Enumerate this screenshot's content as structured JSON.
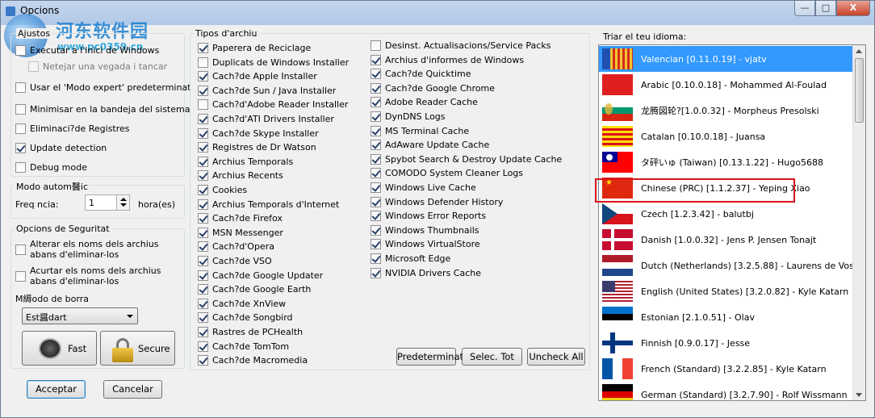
{
  "window": {
    "title": "Opcions",
    "min_label": "—",
    "max_label": "□",
    "close_label": "X"
  },
  "watermark": {
    "site_name": "河东软件园",
    "url": "www.pc0359.cn"
  },
  "left": {
    "general_group": "Ajustos",
    "general": [
      {
        "label": "Executar a l'inici de Windows",
        "checked": false,
        "disabled": false
      },
      {
        "label": "Netejar una vegada i tancar",
        "checked": false,
        "disabled": true
      },
      {
        "label": "Usar el 'Modo expert' predeterminat",
        "checked": false,
        "disabled": false
      },
      {
        "label": "Minimisar en la bandeja del sistema",
        "checked": false,
        "disabled": false
      },
      {
        "label": "Eliminaci?de Registres",
        "checked": false,
        "disabled": false
      },
      {
        "label": "Update detection",
        "checked": true,
        "disabled": false
      },
      {
        "label": "Debug mode",
        "checked": false,
        "disabled": false
      }
    ],
    "auto_group": "Modo autom醫ic",
    "frequency_label": "Freq    ncia:",
    "frequency_value": "1",
    "frequency_unit": "hora(es)",
    "security_group": "Opcions de Seguritat",
    "security": [
      {
        "label": "Alterar els noms dels archius abans d'eliminar-los",
        "checked": false
      },
      {
        "label": "Acurtar els noms dels archius abans d'eliminar-los",
        "checked": false
      }
    ],
    "erase_mode_label": "M縟odo de borra",
    "erase_mode_value": "Est醤dart",
    "fast_label": "Fast",
    "secure_label": "Secure"
  },
  "files": {
    "group": "Tipos d'archiu",
    "col1": [
      {
        "label": "Paperera de Reciclage",
        "checked": true
      },
      {
        "label": "Duplicats de Windows Installer",
        "checked": false
      },
      {
        "label": "Cach?de Apple Installer",
        "checked": true
      },
      {
        "label": "Cach?de Sun / Java Installer",
        "checked": true
      },
      {
        "label": "Cach?d'Adobe Reader Installer",
        "checked": false
      },
      {
        "label": "Cach?d'ATI Drivers Installer",
        "checked": true
      },
      {
        "label": "Cach?de Skype Installer",
        "checked": true
      },
      {
        "label": "Registres de Dr Watson",
        "checked": true
      },
      {
        "label": "Archius Temporals",
        "checked": true
      },
      {
        "label": "Archius Recents",
        "checked": true
      },
      {
        "label": "Cookies",
        "checked": true
      },
      {
        "label": "Archius Temporals d'Internet",
        "checked": true
      },
      {
        "label": "Cach?de Firefox",
        "checked": true
      },
      {
        "label": "MSN Messenger",
        "checked": true
      },
      {
        "label": "Cach?d'Opera",
        "checked": true
      },
      {
        "label": "Cach?de VSO",
        "checked": true
      },
      {
        "label": "Cach?de Google Updater",
        "checked": true
      },
      {
        "label": "Cach?de Google Earth",
        "checked": true
      },
      {
        "label": "Cach?de XnView",
        "checked": true
      },
      {
        "label": "Cach?de Songbird",
        "checked": true
      },
      {
        "label": "Rastres de PCHealth",
        "checked": true
      },
      {
        "label": "Cach?de TomTom",
        "checked": true
      },
      {
        "label": "Cach?de Macromedia",
        "checked": true
      }
    ],
    "col2": [
      {
        "label": "Desinst. Actualisacions/Service Packs",
        "checked": false
      },
      {
        "label": "Archius d'informes de Windows",
        "checked": true
      },
      {
        "label": "Cach?de Quicktime",
        "checked": true
      },
      {
        "label": "Cach?de Google Chrome",
        "checked": true
      },
      {
        "label": "Adobe Reader Cache",
        "checked": true
      },
      {
        "label": "DynDNS Logs",
        "checked": true
      },
      {
        "label": "MS Terminal Cache",
        "checked": true
      },
      {
        "label": "AdAware Update Cache",
        "checked": true
      },
      {
        "label": "Spybot Search & Destroy Update Cache",
        "checked": true
      },
      {
        "label": "COMODO System Cleaner Logs",
        "checked": true
      },
      {
        "label": "Windows Live Cache",
        "checked": true
      },
      {
        "label": "Windows Defender History",
        "checked": true
      },
      {
        "label": "Windows Error Reports",
        "checked": true
      },
      {
        "label": "Windows Thumbnails",
        "checked": true
      },
      {
        "label": "Windows VirtualStore",
        "checked": true
      },
      {
        "label": "Microsoft Edge",
        "checked": true
      },
      {
        "label": "NVIDIA Drivers Cache",
        "checked": true
      }
    ],
    "default_label": "Predeterminat",
    "select_all_label": "Selec. Tot",
    "uncheck_all_label": "Uncheck All"
  },
  "language": {
    "group": "Triar el teu idioma:",
    "items": [
      {
        "label": "Valencian [0.11.0.19] - vjatv",
        "flag": "valencia",
        "selected": true
      },
      {
        "label": "Arabic [0.10.0.18] - Mohammed Al-Foulad",
        "flag": "arabic",
        "selected": false
      },
      {
        "label": "龙腾図轮?[1.0.0.32] - Morpheus Presolski",
        "flag": "bulgaria",
        "selected": false
      },
      {
        "label": "Catalan [0.10.0.18] - Juansa",
        "flag": "catalonia",
        "selected": false
      },
      {
        "label": "タ砰いゅ (Taiwan) [0.13.1.22] - Hugo5688",
        "flag": "taiwan",
        "selected": false
      },
      {
        "label": "Chinese (PRC) [1.1.2.37] - Yeping Xiao",
        "flag": "china",
        "selected": false
      },
      {
        "label": "Czech [1.2.3.42] - balutbj",
        "flag": "czech",
        "selected": false
      },
      {
        "label": "Danish [1.0.0.32] - Jens P. Jensen Tonajt",
        "flag": "denmark",
        "selected": false
      },
      {
        "label": "Dutch (Netherlands) [3.2.5.88] - Laurens de Vos",
        "flag": "netherlands",
        "selected": false
      },
      {
        "label": "English (United States) [3.2.0.82] - Kyle Katarn",
        "flag": "usa",
        "selected": false
      },
      {
        "label": "Estonian [2.1.0.51] - Olav",
        "flag": "estonia",
        "selected": false
      },
      {
        "label": "Finnish [0.9.0.17] - Jesse",
        "flag": "finland",
        "selected": false
      },
      {
        "label": "French (Standard) [3.2.2.85] - Kyle Katarn",
        "flag": "france",
        "selected": false
      },
      {
        "label": "German (Standard) [3.2.7.90] - Rolf Wissmann",
        "flag": "germany",
        "selected": false
      }
    ]
  },
  "footer": {
    "accept_label": "Acceptar",
    "cancel_label": "Cancelar"
  },
  "colors": {
    "selection": "#3399ff",
    "highlight_box": "#d8141d",
    "window_bg": "#f0f0f0"
  }
}
